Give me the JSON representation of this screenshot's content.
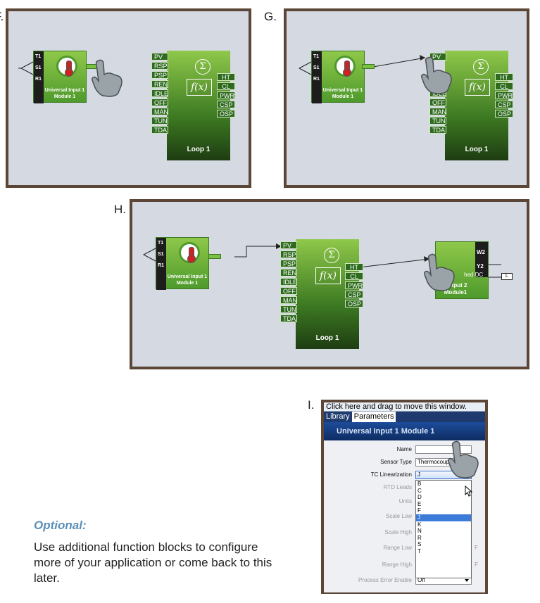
{
  "labels": {
    "f": "F.",
    "g": "G.",
    "h": "H.",
    "i": "I."
  },
  "ui_block": {
    "pins": [
      "T1",
      "S1",
      "R1"
    ],
    "title_line1": "Universal Input 1",
    "title_line2": "Module 1"
  },
  "loop_block": {
    "title": "Loop 1",
    "inputs": [
      "PV",
      "RSP",
      "PSP",
      "REN",
      "IDLE",
      "OFF",
      "MAN",
      "TUN",
      "TDA"
    ],
    "outputs": [
      "HT",
      "CL",
      "PWR",
      "CSP",
      "OSP"
    ]
  },
  "output_block": {
    "pins": [
      "W2",
      "Y2"
    ],
    "subtitle": "hed DC",
    "title_line1": "Output 2",
    "title_line2": "Module1",
    "load_label": "L"
  },
  "window": {
    "drag_bar": "Click here and drag to move this window.",
    "tabs": [
      "Library",
      "Parameters"
    ],
    "header": "Universal Input 1 Module 1",
    "fields": [
      {
        "label": "Name",
        "value": ""
      },
      {
        "label": "Sensor Type",
        "value": "Thermocouple"
      },
      {
        "label": "TC Linearization",
        "value": "J"
      },
      {
        "label": "RTD Leads",
        "value": ""
      },
      {
        "label": "Units",
        "value": ""
      },
      {
        "label": "Scale Low",
        "value": ""
      },
      {
        "label": "Scale High",
        "value": ""
      },
      {
        "label": "Range Low",
        "value": "",
        "unit": "F"
      },
      {
        "label": "Range High",
        "value": "",
        "unit": "F"
      },
      {
        "label": "Process Error Enable",
        "value": "Off"
      }
    ],
    "dropdown_options": [
      "B",
      "C",
      "D",
      "E",
      "F",
      "J",
      "K",
      "N",
      "R",
      "S",
      "T"
    ],
    "dropdown_selected": "J"
  },
  "optional": {
    "title": "Optional:",
    "text": "Use additional function blocks to configure more of your application or come back to this later."
  },
  "colors": {
    "frame": "#5b4637",
    "canvas": "#d4d9e2",
    "block_green": "#7ac143",
    "accent_blue": "#5a8fb8"
  }
}
